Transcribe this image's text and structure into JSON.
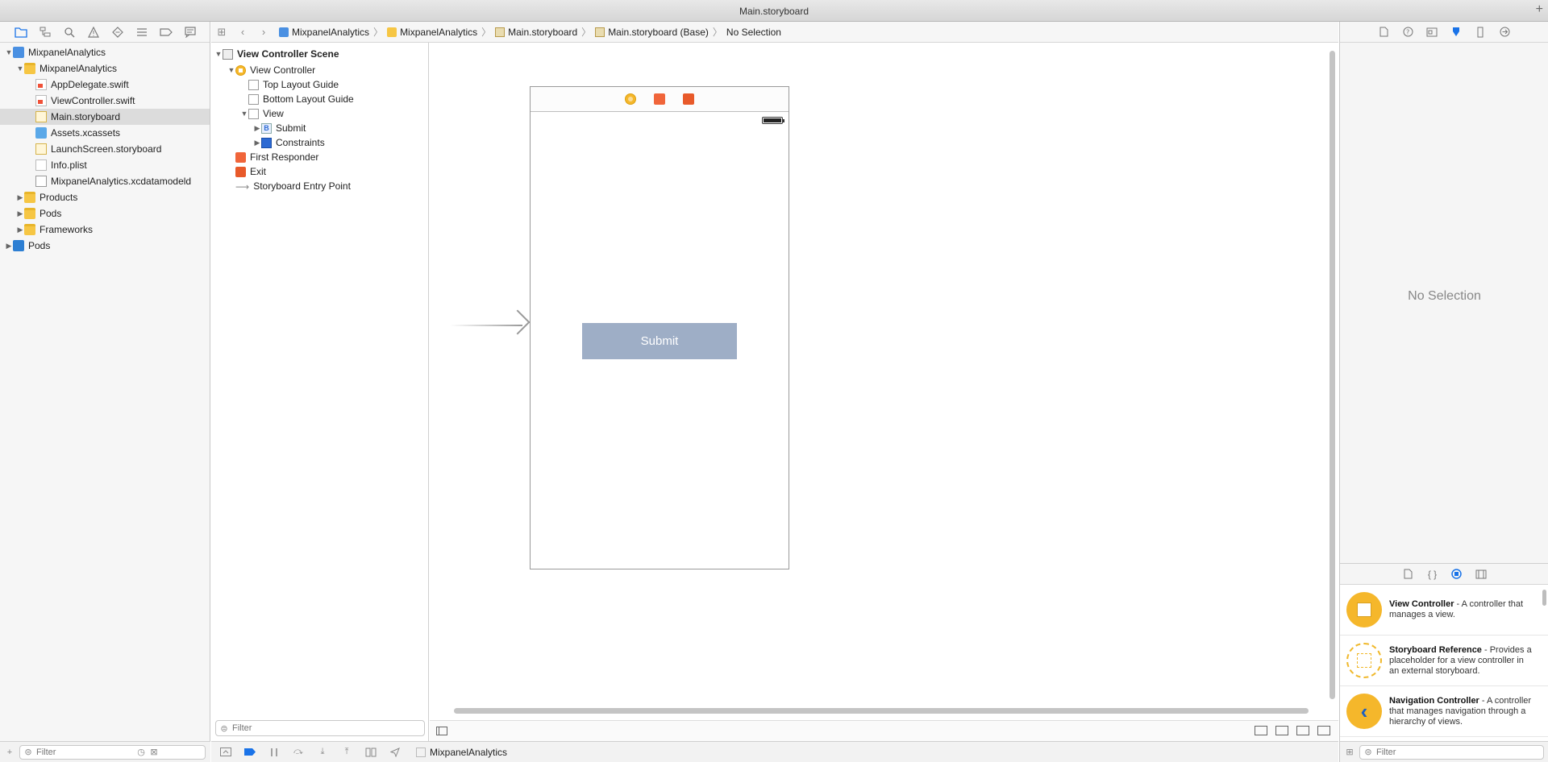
{
  "window": {
    "title": "Main.storyboard"
  },
  "navigator": {
    "tree": [
      {
        "label": "MixpanelAnalytics",
        "kind": "proj",
        "indent": 0,
        "disclosure": "open"
      },
      {
        "label": "MixpanelAnalytics",
        "kind": "folder",
        "indent": 1,
        "disclosure": "open"
      },
      {
        "label": "AppDelegate.swift",
        "kind": "swift",
        "indent": 2,
        "disclosure": "none"
      },
      {
        "label": "ViewController.swift",
        "kind": "swift",
        "indent": 2,
        "disclosure": "none"
      },
      {
        "label": "Main.storyboard",
        "kind": "sb",
        "indent": 2,
        "disclosure": "none",
        "selected": true
      },
      {
        "label": "Assets.xcassets",
        "kind": "assets",
        "indent": 2,
        "disclosure": "none"
      },
      {
        "label": "LaunchScreen.storyboard",
        "kind": "sb",
        "indent": 2,
        "disclosure": "none"
      },
      {
        "label": "Info.plist",
        "kind": "plist",
        "indent": 2,
        "disclosure": "none"
      },
      {
        "label": "MixpanelAnalytics.xcdatamodeld",
        "kind": "xcd",
        "indent": 2,
        "disclosure": "none"
      },
      {
        "label": "Products",
        "kind": "folder",
        "indent": 1,
        "disclosure": "closed"
      },
      {
        "label": "Pods",
        "kind": "folder",
        "indent": 1,
        "disclosure": "closed"
      },
      {
        "label": "Frameworks",
        "kind": "folder",
        "indent": 1,
        "disclosure": "closed"
      },
      {
        "label": "Pods",
        "kind": "podsproj",
        "indent": 0,
        "disclosure": "closed"
      }
    ],
    "filter_placeholder": "Filter"
  },
  "jumpbar": {
    "crumbs": [
      "MixpanelAnalytics",
      "MixpanelAnalytics",
      "Main.storyboard",
      "Main.storyboard (Base)",
      "No Selection"
    ]
  },
  "outline": {
    "items": [
      {
        "label": "View Controller Scene",
        "icon": "scene",
        "indent": 0,
        "disclosure": "open",
        "bold": true
      },
      {
        "label": "View Controller",
        "icon": "vc",
        "indent": 1,
        "disclosure": "open"
      },
      {
        "label": "Top Layout Guide",
        "icon": "guide",
        "indent": 2,
        "disclosure": "none"
      },
      {
        "label": "Bottom Layout Guide",
        "icon": "guide",
        "indent": 2,
        "disclosure": "none"
      },
      {
        "label": "View",
        "icon": "view",
        "indent": 2,
        "disclosure": "open"
      },
      {
        "label": "Submit",
        "icon": "btn",
        "indent": 3,
        "disclosure": "closed"
      },
      {
        "label": "Constraints",
        "icon": "cons",
        "indent": 3,
        "disclosure": "closed"
      },
      {
        "label": "First Responder",
        "icon": "fr",
        "indent": 1,
        "disclosure": "none"
      },
      {
        "label": "Exit",
        "icon": "exit",
        "indent": 1,
        "disclosure": "none"
      },
      {
        "label": "Storyboard Entry Point",
        "icon": "arrow",
        "indent": 1,
        "disclosure": "none"
      }
    ],
    "filter_placeholder": "Filter"
  },
  "canvas": {
    "button_label": "Submit"
  },
  "inspector": {
    "empty_text": "No Selection",
    "library": [
      {
        "name": "View Controller",
        "desc": " - A controller that manages a view.",
        "icon": "vc"
      },
      {
        "name": "Storyboard Reference",
        "desc": " - Provides a placeholder for a view controller in an external storyboard.",
        "icon": "ref"
      },
      {
        "name": "Navigation Controller",
        "desc": " - A controller that manages navigation through a hierarchy of views.",
        "icon": "nav"
      }
    ],
    "filter_placeholder": "Filter"
  },
  "debugbar": {
    "scheme": "MixpanelAnalytics"
  }
}
